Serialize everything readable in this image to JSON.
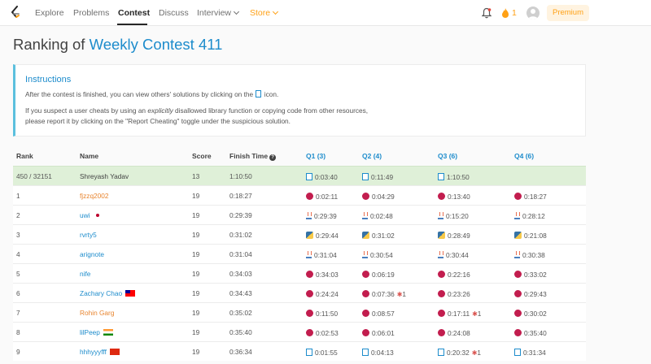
{
  "nav": {
    "items": [
      "Explore",
      "Problems",
      "Contest",
      "Discuss",
      "Interview",
      "Store"
    ],
    "streak": "1",
    "premium": "Premium"
  },
  "page": {
    "title_prefix": "Ranking of ",
    "title_contest": "Weekly Contest 411"
  },
  "instructions": {
    "heading": "Instructions",
    "line1_a": "After the contest is finished, you can view others' solutions by clicking on the ",
    "line1_b": " icon.",
    "line2_a": "If you suspect a user cheats by using an ",
    "line2_em": "explicitly",
    "line2_b": " disallowed library function or copying code from other resources,",
    "line3": "please report it by clicking on the \"Report Cheating\" toggle under the suspicious solution."
  },
  "table": {
    "headers": {
      "rank": "Rank",
      "name": "Name",
      "score": "Score",
      "finish": "Finish Time",
      "q1": "Q1 (3)",
      "q2": "Q2 (4)",
      "q3": "Q3 (6)",
      "q4": "Q4 (6)"
    },
    "rows": [
      {
        "rank": "450 / 32151",
        "name": "Shreyash Yadav",
        "score": "13",
        "finish": "1:10:50",
        "q1": "0:03:40",
        "q2": "0:11:49",
        "q3": "1:10:50",
        "q4": ""
      },
      {
        "rank": "1",
        "name": "fjzzq2002",
        "score": "19",
        "finish": "0:18:27",
        "q1": "0:02:11",
        "q2": "0:04:29",
        "q3": "0:13:40",
        "q4": "0:18:27"
      },
      {
        "rank": "2",
        "name": "uwi",
        "score": "19",
        "finish": "0:29:39",
        "q1": "0:29:39",
        "q2": "0:02:48",
        "q3": "0:15:20",
        "q4": "0:28:12"
      },
      {
        "rank": "3",
        "name": "rvrty5",
        "score": "19",
        "finish": "0:31:02",
        "q1": "0:29:44",
        "q2": "0:31:02",
        "q3": "0:28:49",
        "q4": "0:21:08"
      },
      {
        "rank": "4",
        "name": "arignote",
        "score": "19",
        "finish": "0:31:04",
        "q1": "0:31:04",
        "q2": "0:30:54",
        "q3": "0:30:44",
        "q4": "0:30:38"
      },
      {
        "rank": "5",
        "name": "nife",
        "score": "19",
        "finish": "0:34:03",
        "q1": "0:34:03",
        "q2": "0:06:19",
        "q3": "0:22:16",
        "q4": "0:33:02"
      },
      {
        "rank": "6",
        "name": "Zachary Chao",
        "score": "19",
        "finish": "0:34:43",
        "q1": "0:24:24",
        "q2": "0:07:36",
        "q2_bug": "1",
        "q3": "0:23:26",
        "q4": "0:29:43"
      },
      {
        "rank": "7",
        "name": "Rohin Garg",
        "score": "19",
        "finish": "0:35:02",
        "q1": "0:11:50",
        "q2": "0:08:57",
        "q3": "0:17:11",
        "q3_bug": "1",
        "q4": "0:30:02"
      },
      {
        "rank": "8",
        "name": "lilPeep",
        "score": "19",
        "finish": "0:35:40",
        "q1": "0:02:53",
        "q2": "0:06:01",
        "q3": "0:24:08",
        "q4": "0:35:40"
      },
      {
        "rank": "9",
        "name": "hhhyyyfff",
        "score": "19",
        "finish": "0:36:34",
        "q1": "0:01:55",
        "q2": "0:04:13",
        "q3": "0:20:32",
        "q3_bug": "1",
        "q4": "0:31:34"
      }
    ]
  }
}
